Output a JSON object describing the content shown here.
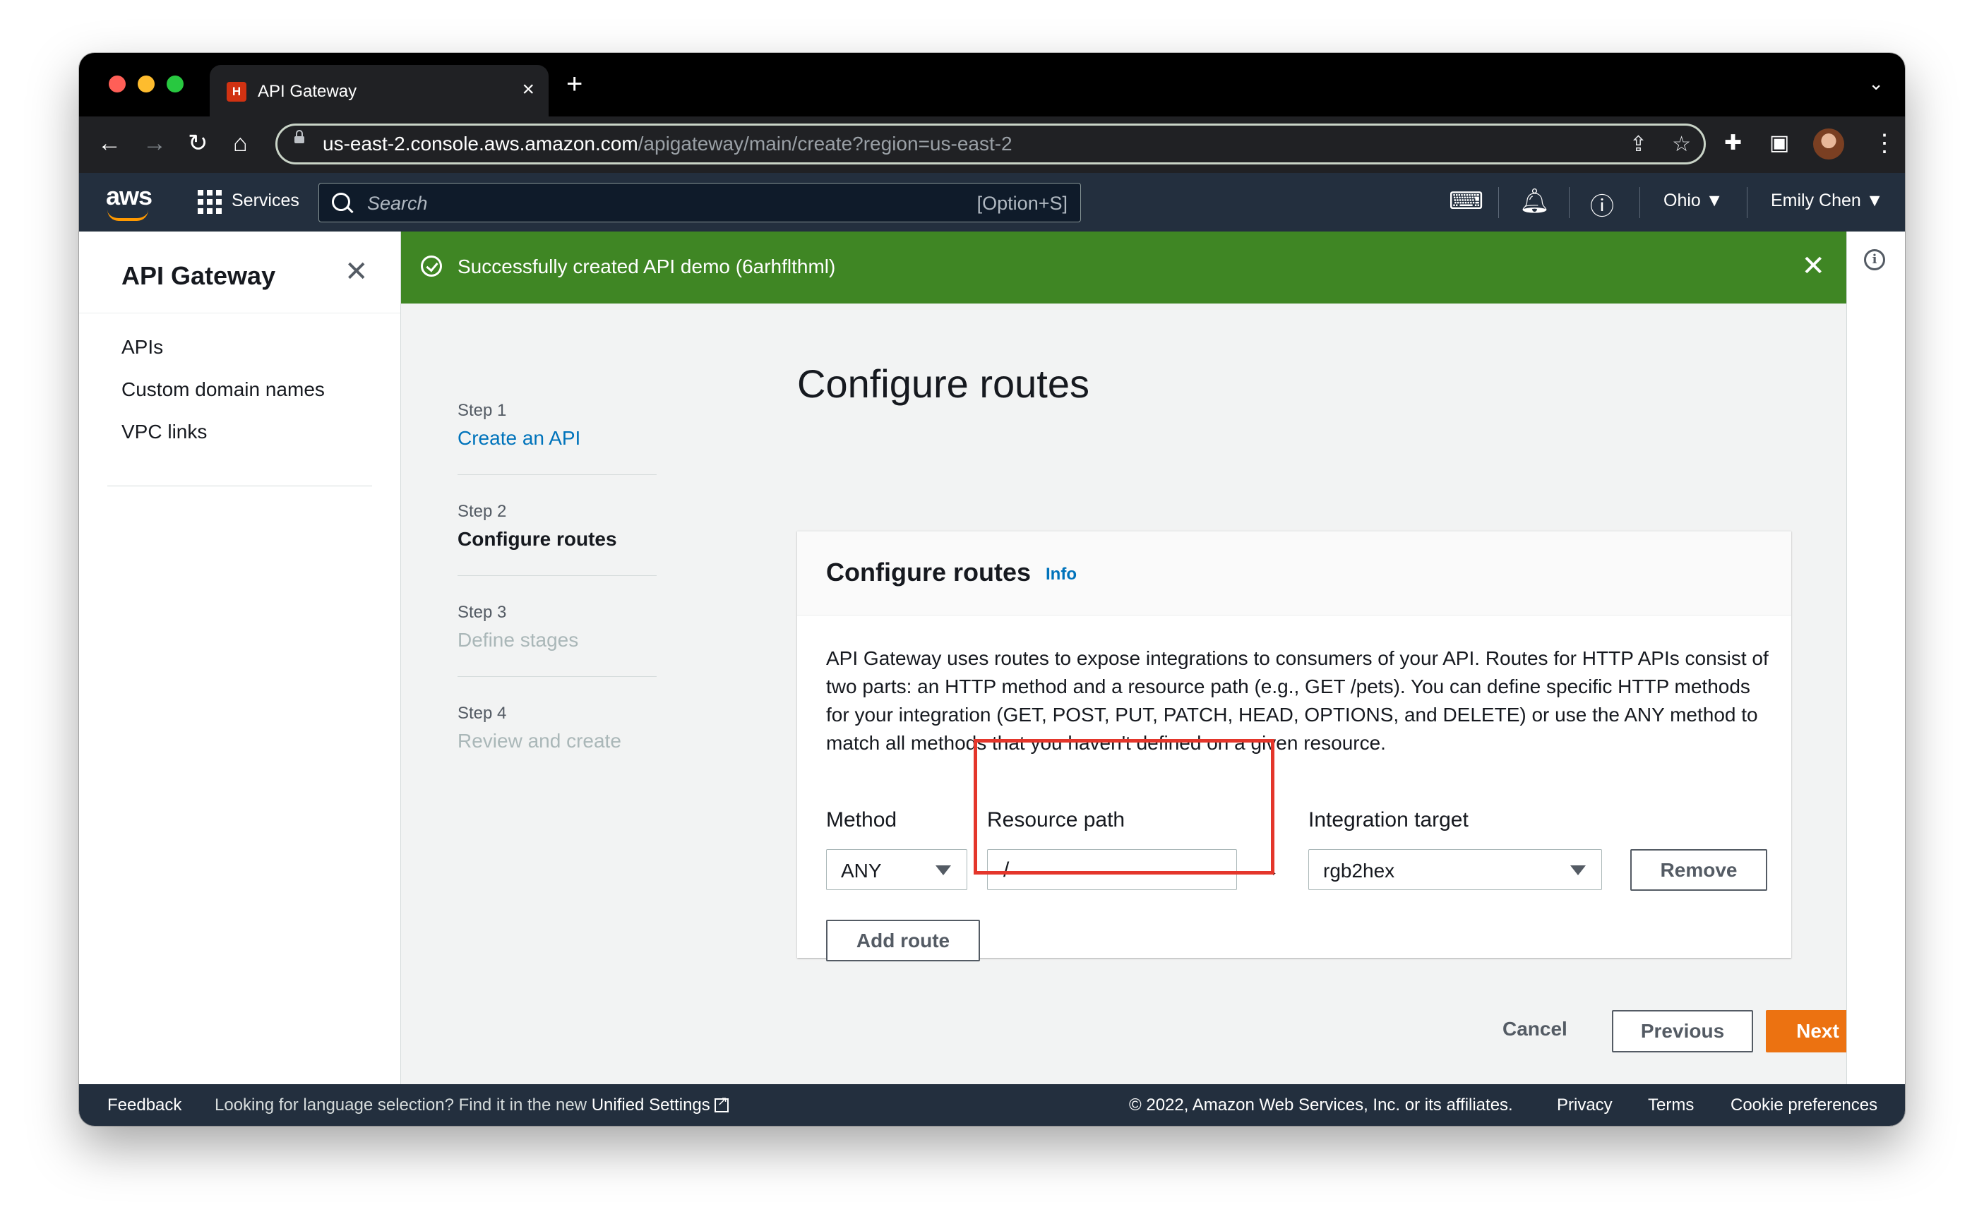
{
  "browser": {
    "tab_title": "API Gateway",
    "tab_favicon": "H",
    "url_host": "us-east-2.console.aws.amazon.com",
    "url_path": "/apigateway/main/create?region=us-east-2",
    "traffic_colors": [
      "#ff5f57",
      "#febc2e",
      "#28c840"
    ]
  },
  "aws_nav": {
    "logo": "aws",
    "services_label": "Services",
    "search_placeholder": "Search",
    "search_shortcut": "[Option+S]",
    "region": "Ohio ▼",
    "user": "Emily Chen ▼"
  },
  "side_panel": {
    "title": "API Gateway",
    "links": [
      "APIs",
      "Custom domain names",
      "VPC links"
    ]
  },
  "flash": {
    "message": "Successfully created API demo (6arhflthml)",
    "color": "#3f8624"
  },
  "steps": [
    {
      "label": "Step 1",
      "name": "Create an API",
      "state": "link"
    },
    {
      "label": "Step 2",
      "name": "Configure routes",
      "state": "current"
    },
    {
      "label": "Step 3",
      "name": "Define stages",
      "state": "disabled"
    },
    {
      "label": "Step 4",
      "name": "Review and create",
      "state": "disabled"
    }
  ],
  "page_title": "Configure routes",
  "card": {
    "title": "Configure routes",
    "info_label": "Info",
    "description": "API Gateway uses routes to expose integrations to consumers of your API. Routes for HTTP APIs consist of two parts: an HTTP method and a resource path (e.g., GET /pets). You can define specific HTTP methods for your integration (GET, POST, PUT, PATCH, HEAD, OPTIONS, and DELETE) or use the ANY method to match all methods that you haven't defined on a given resource.",
    "method_label": "Method",
    "method_value": "ANY",
    "resource_label": "Resource path",
    "resource_value": "/",
    "target_label": "Integration target",
    "target_value": "rgb2hex",
    "remove_label": "Remove",
    "add_route_label": "Add route"
  },
  "actions": {
    "cancel": "Cancel",
    "previous": "Previous",
    "next": "Next",
    "primary_color": "#ec7211"
  },
  "footer": {
    "feedback": "Feedback",
    "language_text": "Looking for language selection? Find it in the new",
    "unified_settings": "Unified Settings",
    "copyright": "© 2022, Amazon Web Services, Inc. or its affiliates.",
    "privacy": "Privacy",
    "terms": "Terms",
    "cookie": "Cookie preferences"
  }
}
